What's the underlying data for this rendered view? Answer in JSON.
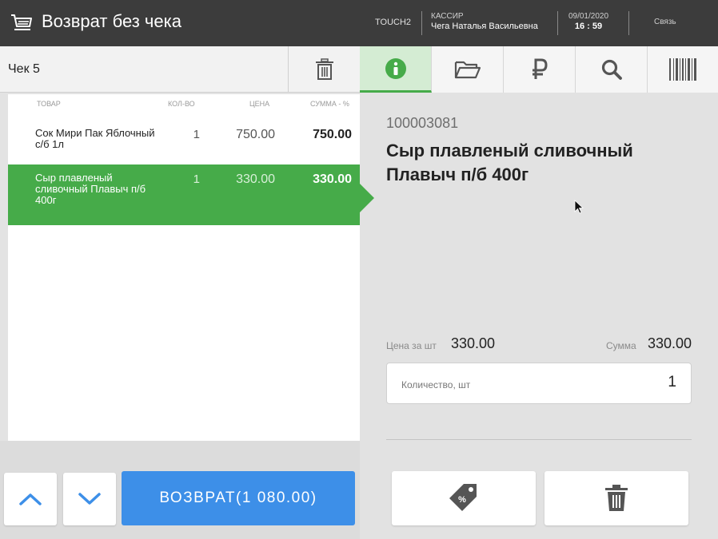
{
  "header": {
    "title": "Возврат без чека",
    "terminal": "TOUCH2",
    "cashier_label": "КАССИР",
    "cashier_name": "Чега Наталья Васильевна",
    "date": "09/01/2020",
    "time": "16 : 59",
    "link_label": "Связь"
  },
  "receipt": {
    "title": "Чек 5",
    "columns": {
      "product": "ТОВАР",
      "qty": "КОЛ-ВО",
      "price": "ЦЕНА",
      "sum": "СУММА - %"
    },
    "items": [
      {
        "name": "Сок Мири Пак Яблочный с/б 1л",
        "qty": "1",
        "price": "750.00",
        "sum": "750.00"
      },
      {
        "name": "Сыр плавленый сливочный Плавыч п/б 400г",
        "qty": "1",
        "price": "330.00",
        "sum": "330.00"
      }
    ],
    "return_button": "ВОЗВРАТ(1 080.00)"
  },
  "detail": {
    "code": "100003081",
    "name": "Сыр плавленый сливочный Плавыч п/б 400г",
    "price_label": "Цена за шт",
    "price_value": "330.00",
    "sum_label": "Сумма",
    "sum_value": "330.00",
    "qty_placeholder": "Количество, шт",
    "qty_value": "1"
  },
  "tabs": [
    {
      "icon": "info-icon",
      "active": true
    },
    {
      "icon": "folder-icon",
      "active": false
    },
    {
      "icon": "ruble-icon",
      "active": false
    },
    {
      "icon": "search-icon",
      "active": false
    },
    {
      "icon": "barcode-icon",
      "active": false
    }
  ],
  "colors": {
    "accent_green": "#46ab49",
    "accent_blue": "#3d8fe8",
    "header_bg": "#3c3c3c"
  }
}
